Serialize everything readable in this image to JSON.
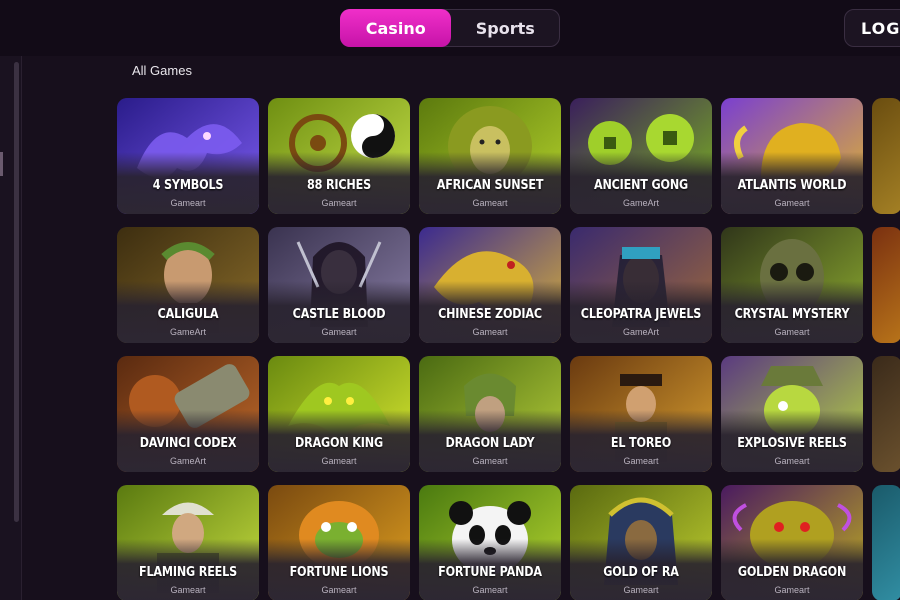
{
  "header": {
    "tabs": [
      {
        "label": "Casino",
        "active": true
      },
      {
        "label": "Sports",
        "active": false
      }
    ],
    "login_label": "LOG I"
  },
  "section": {
    "label": "All Games"
  },
  "colors": {
    "accent": "#e523c0",
    "background": "#170f1c",
    "card": "#2d2733"
  },
  "games": [
    {
      "title": "4 SYMBOLS",
      "provider": "Gameart",
      "art": "purple-dragon",
      "c1": "#2a1c8a",
      "c2": "#7c5cf0"
    },
    {
      "title": "88 RICHES",
      "provider": "Gameart",
      "art": "yin-yang-wheel",
      "c1": "#6f8f12",
      "c2": "#c8e24a"
    },
    {
      "title": "AFRICAN SUNSET",
      "provider": "Gameart",
      "art": "lion",
      "c1": "#5c7a0e",
      "c2": "#b5d32c"
    },
    {
      "title": "ANCIENT GONG",
      "provider": "GameArt",
      "art": "coins",
      "c1": "#3a1f5c",
      "c2": "#7db620"
    },
    {
      "title": "ATLANTIS WORLD",
      "provider": "Gameart",
      "art": "golden-lion",
      "c1": "#7a3fd0",
      "c2": "#e3b72a"
    },
    {
      "title": "",
      "provider": "",
      "art": "partial",
      "c1": "#6a4d10",
      "c2": "#c9a132"
    },
    {
      "title": "CALIGULA",
      "provider": "GameArt",
      "art": "emperor",
      "c1": "#3d2e10",
      "c2": "#8a6c2a"
    },
    {
      "title": "CASTLE BLOOD",
      "provider": "Gameart",
      "art": "vampire",
      "c1": "#3a3350",
      "c2": "#8a7fa6"
    },
    {
      "title": "CHINESE ZODIAC",
      "provider": "Gameart",
      "art": "golden-dragon",
      "c1": "#3b2a8f",
      "c2": "#d9b23a"
    },
    {
      "title": "CLEOPATRA JEWELS",
      "provider": "GameArt",
      "art": "cleopatra",
      "c1": "#3a2a6e",
      "c2": "#a06a3a"
    },
    {
      "title": "CRYSTAL MYSTERY",
      "provider": "Gameart",
      "art": "mask",
      "c1": "#30361a",
      "c2": "#8fae30"
    },
    {
      "title": "",
      "provider": "",
      "art": "partial",
      "c1": "#7a3010",
      "c2": "#e0a020"
    },
    {
      "title": "DAVINCI CODEX",
      "provider": "GameArt",
      "art": "cryptex",
      "c1": "#5a2a10",
      "c2": "#c06a2a"
    },
    {
      "title": "DRAGON KING",
      "provider": "Gameart",
      "art": "green-dragon",
      "c1": "#6a8a10",
      "c2": "#d8e830"
    },
    {
      "title": "DRAGON LADY",
      "provider": "Gameart",
      "art": "warrior",
      "c1": "#4a6a12",
      "c2": "#b7cf3a"
    },
    {
      "title": "EL TOREO",
      "provider": "Gameart",
      "art": "toreador",
      "c1": "#6a3a10",
      "c2": "#d9a030"
    },
    {
      "title": "EXPLOSIVE REELS",
      "provider": "Gameart",
      "art": "pirate",
      "c1": "#5a3a80",
      "c2": "#b8d840"
    },
    {
      "title": "",
      "provider": "",
      "art": "partial",
      "c1": "#3a2a1a",
      "c2": "#8a6a3a"
    },
    {
      "title": "FLAMING REELS",
      "provider": "Gameart",
      "art": "fireman",
      "c1": "#5a7a10",
      "c2": "#c8de40"
    },
    {
      "title": "FORTUNE LIONS",
      "provider": "Gameart",
      "art": "lion-dance",
      "c1": "#7a4a10",
      "c2": "#e0a020"
    },
    {
      "title": "FORTUNE PANDA",
      "provider": "Gameart",
      "art": "panda",
      "c1": "#4a7a10",
      "c2": "#b8d830"
    },
    {
      "title": "GOLD OF RA",
      "provider": "Gameart",
      "art": "pharaoh",
      "c1": "#5a6a10",
      "c2": "#c0d030"
    },
    {
      "title": "GOLDEN DRAGON",
      "provider": "Gameart",
      "art": "dragon-head",
      "c1": "#4a1a60",
      "c2": "#c0b020"
    },
    {
      "title": "",
      "provider": "",
      "art": "partial",
      "c1": "#1a5a6a",
      "c2": "#40b0c8"
    }
  ]
}
